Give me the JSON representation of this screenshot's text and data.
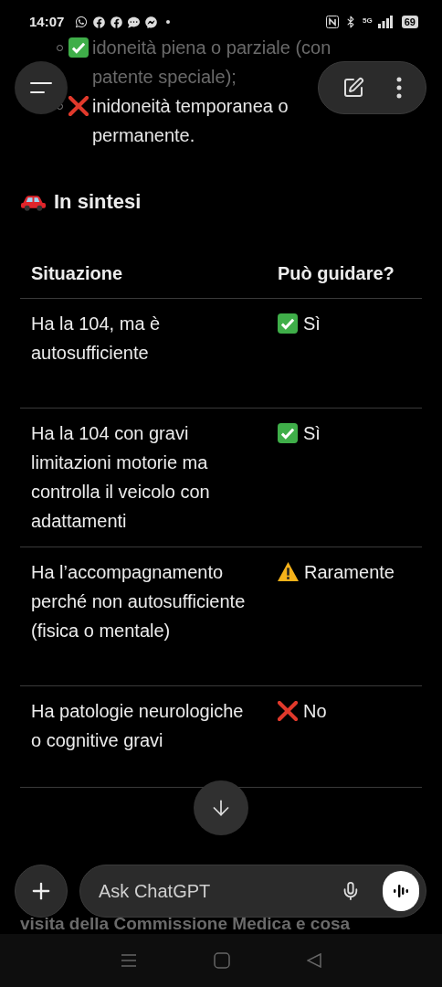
{
  "status_bar": {
    "time": "14:07",
    "network": "5G",
    "battery": "69"
  },
  "list": [
    {
      "kind": "check",
      "text": "idoneità piena o parziale (con patente speciale);"
    },
    {
      "kind": "cross",
      "text": "inidoneità temporanea o permanente."
    }
  ],
  "heading": {
    "text": "In sintesi"
  },
  "table": {
    "columns": [
      "Situazione",
      "Può guidare?"
    ],
    "rows": [
      {
        "situation": "Ha la 104, ma è autosufficiente",
        "kind": "yes",
        "answer": "Sì"
      },
      {
        "situation": "Ha la 104 con gravi limitazioni motorie ma controlla il veicolo con adattamenti",
        "kind": "yes",
        "answer": "Sì"
      },
      {
        "situation": "Ha l’accompagnamento perché non autosufficiente (fisica o mentale)",
        "kind": "warning",
        "answer": "Raramente"
      },
      {
        "situation": "Ha patologie neurologiche o cognitive gravi",
        "kind": "no",
        "answer": "No"
      }
    ]
  },
  "trailing_text": "visita della Commissione Medica e cosa",
  "composer": {
    "placeholder": "Ask ChatGPT"
  }
}
